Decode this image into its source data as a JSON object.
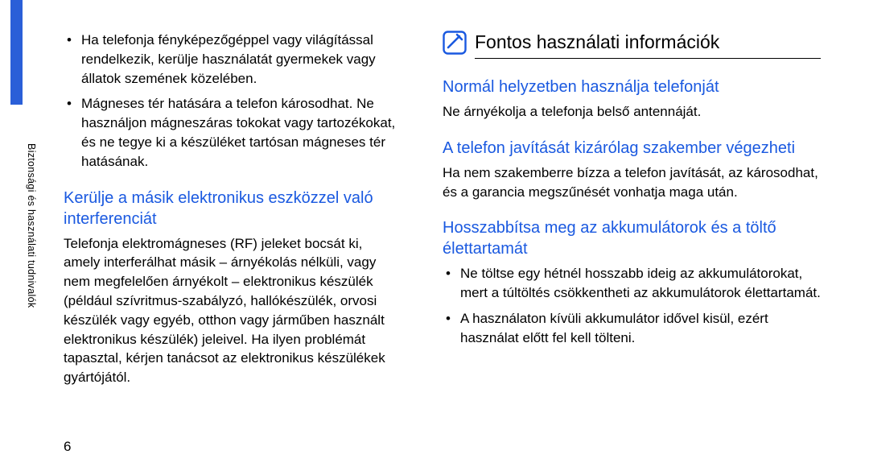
{
  "side_label": "Biztonsági és használati tudnivalók",
  "page_number": "6",
  "left": {
    "bullets": [
      "Ha telefonja fényképezőgéppel vagy világítással rendelkezik, kerülje használatát gyermekek vagy állatok szemének közelében.",
      "Mágneses tér hatására a telefon károsodhat. Ne használjon mágneszáras tokokat vagy tartozékokat, és ne tegye ki a készüléket tartósan mágneses tér hatásának."
    ],
    "h3": "Kerülje a másik elektronikus eszközzel való interferenciát",
    "para": "Telefonja elektromágneses (RF) jeleket bocsát ki, amely interferálhat másik – árnyékolás nélküli, vagy nem megfelelően árnyékolt – elektronikus készülék (például szívritmus-szabályzó, hallókészülék, orvosi készülék vagy egyéb, otthon vagy járműben használt elektronikus készülék) jeleivel. Ha ilyen problémát tapasztal, kérjen tanácsot az elektronikus készülékek gyártójától."
  },
  "right": {
    "title": "Fontos használati információk",
    "s1_h3": "Normál helyzetben használja telefonját",
    "s1_p": "Ne árnyékolja a telefonja belső antennáját.",
    "s2_h3": "A telefon javítását kizárólag szakember végezheti",
    "s2_p": "Ha nem szakemberre bízza a telefon javítását, az károsodhat, és a garancia megszűnését vonhatja maga után.",
    "s3_h3": "Hosszabbítsa meg az akkumulátorok és a töltő élettartamát",
    "s3_bullets": [
      "Ne töltse egy hétnél hosszabb ideig az akkumulátorokat, mert a túltöltés csökkentheti az akkumulátorok élettartamát.",
      "A használaton kívüli akkumulátor idővel kisül, ezért használat előtt fel kell tölteni."
    ]
  }
}
